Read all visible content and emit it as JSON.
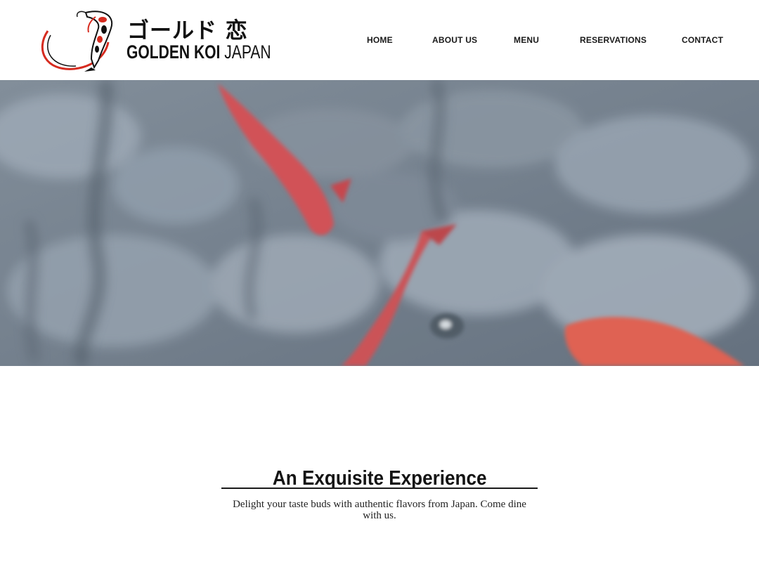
{
  "brand": {
    "name_jp": "ゴールド 恋",
    "name_en_bold": "GOLDEN KOI",
    "name_en_light": "JAPAN",
    "logo_icon": "koi-fish-icon"
  },
  "nav": {
    "items": [
      {
        "label": "HOME"
      },
      {
        "label": "ABOUT US"
      },
      {
        "label": "MENU"
      },
      {
        "label": "RESERVATIONS"
      },
      {
        "label": "CONTACT"
      }
    ]
  },
  "hero": {
    "media": "koi-pond-video"
  },
  "intro": {
    "title": "An Exquisite Experience",
    "body": "Delight your taste buds with authentic flavors from Japan. Come dine with us."
  },
  "colors": {
    "accent": "#d62b1f",
    "text": "#111111",
    "background": "#ffffff"
  }
}
